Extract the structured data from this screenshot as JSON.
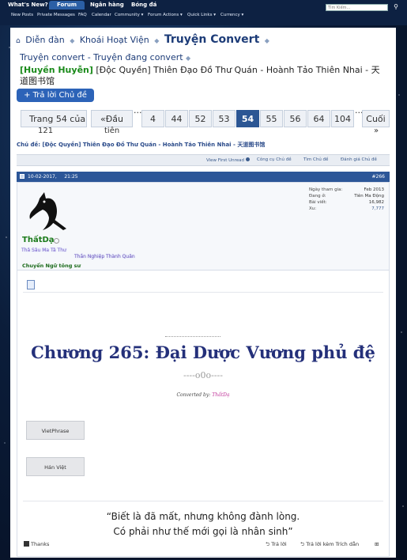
{
  "topnav": {
    "items": [
      "What's New?",
      "Forum",
      "Ngân hàng",
      "Bóng đá"
    ],
    "sub_items": [
      "New Posts",
      "Private Messages",
      "FAQ",
      "Calendar",
      "Community",
      "Forum Actions",
      "Quick Links",
      "Currency"
    ],
    "search_placeholder": "Tìm Kiếm...",
    "search_icon": "magnifier-icon"
  },
  "breadcrumb": {
    "items": [
      "Diễn đàn",
      "Khoái Hoạt Viện",
      "Truyện Convert"
    ],
    "sub_item": "Truyện convert - Truyện đang convert"
  },
  "thread": {
    "tag": "[Huyền Huyễn]",
    "title": "[Độc Quyền] Thiên Đạo Đồ Thư Quán - Hoành Tảo Thiên Nhai - 天道图书馆",
    "reply_button": "+ Trả lời Chủ đề",
    "topic_line": "Chủ đề: [Độc Quyền] Thiên Đạo Đồ Thư Quán - Hoành Tảo Thiên Nhai - 天道图书馆"
  },
  "pager": {
    "page_of": "Trang 54 của",
    "total": "121",
    "first": "«Đầu",
    "first_suffix": "tiên",
    "pages": [
      "4",
      "44",
      "52",
      "53",
      "54",
      "55",
      "56",
      "64",
      "104"
    ],
    "current": "54",
    "last": "Cuối",
    "next": "»"
  },
  "toolbar": {
    "first_unread": "View First Unread",
    "tools": "Công cụ Chủ đề",
    "search": "Tìm Chủ đề",
    "rate": "Đánh giá Chủ đề"
  },
  "post": {
    "date": "10-02-2017,",
    "time": "21:25",
    "number": "#266",
    "username": "ThấtDạ",
    "user_title_1": "Thâ Sâu Ma Tâ Thư",
    "user_title_2": "Thần Nghiệp Thành Quân",
    "user_rank": "Chuyển Ngữ tông sư",
    "stats": [
      {
        "label": "Ngày tham gia:",
        "value": "Feb 2013"
      },
      {
        "label": "Đang ở:",
        "value": "Tiên Ma Động"
      },
      {
        "label": "Bài viết:",
        "value": "16,982"
      },
      {
        "label": "Xu:",
        "value": "7,777"
      }
    ],
    "chapter_title": "Chương 265: Đại Dược Vương phủ đệ",
    "separator": "----o0o----",
    "converted_by": "Converted by:",
    "converter": "ThấtDạ",
    "buttons": [
      "VietPhrase",
      "Hán Việt"
    ],
    "quote_line1": "“Biết là đã mất, nhưng không đành lòng.",
    "quote_line2": "Có phải như thế mới gọi là nhân sinh”"
  },
  "post_footer": {
    "thanks": "Thanks",
    "reply": "Trả lời",
    "reply_quote": "Trả lời kèm Trích dẫn"
  }
}
